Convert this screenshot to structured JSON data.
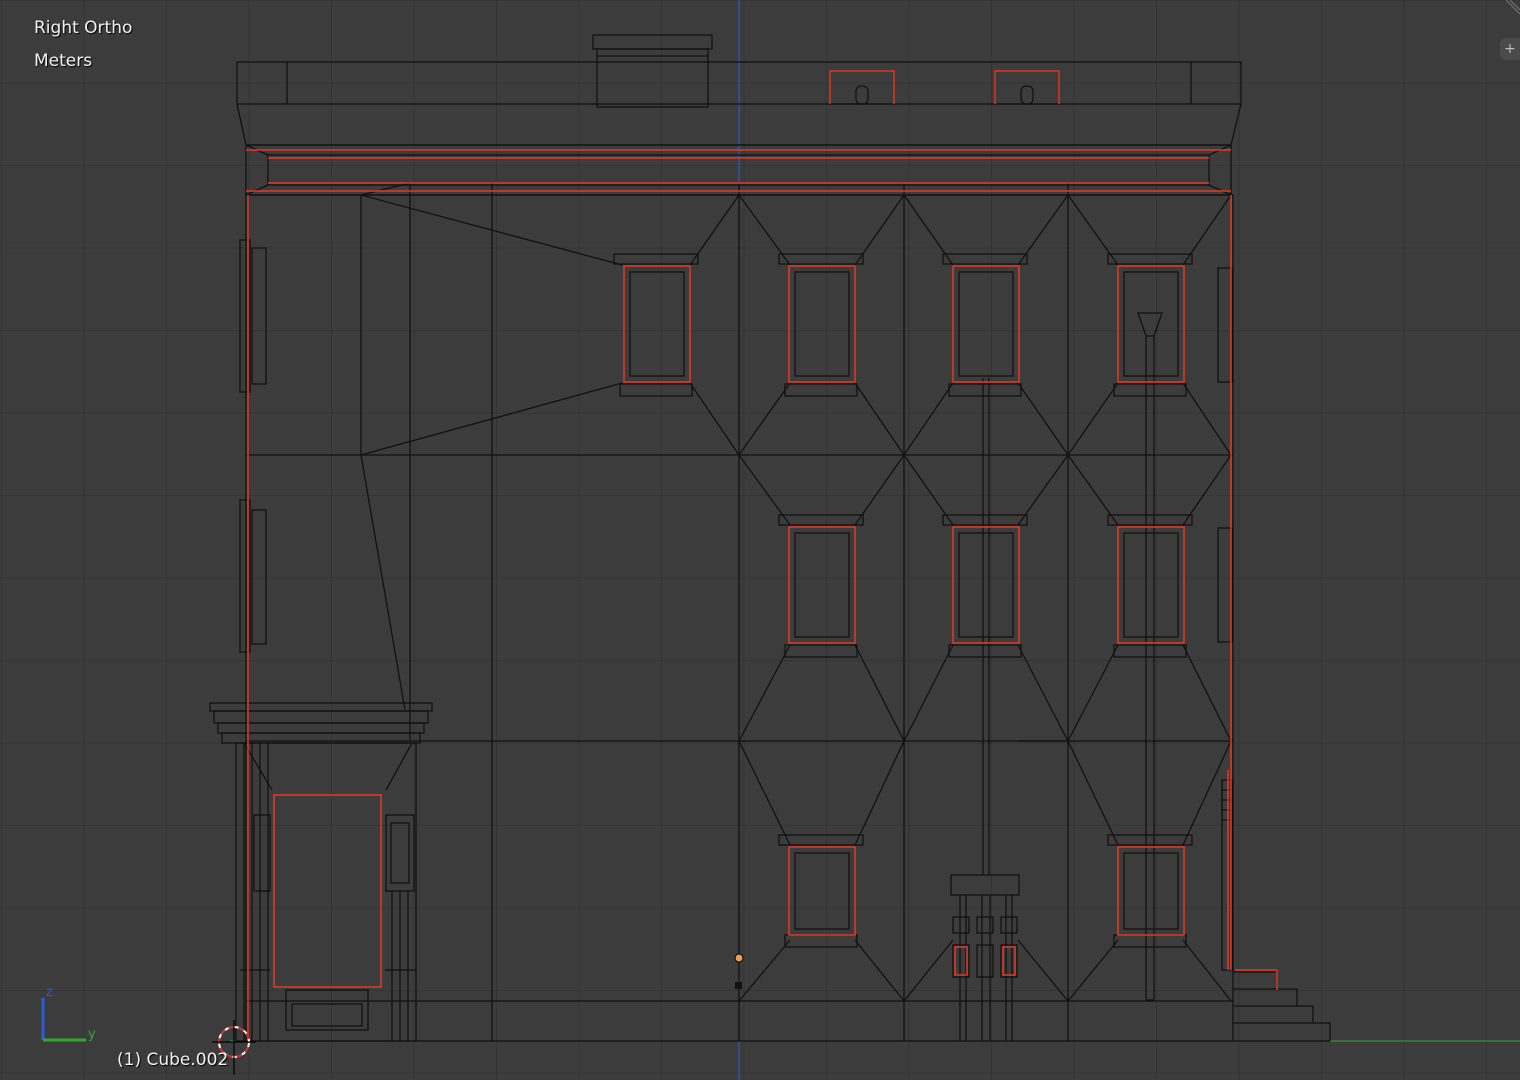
{
  "viewport": {
    "view_name": "Right Ortho",
    "units": "Meters",
    "active_object": "(1) Cube.002",
    "panel_toggle": "+",
    "axis_labels": {
      "z": "z",
      "y": "y"
    }
  },
  "colors": {
    "background": "#3c3c3c",
    "wire": "#111111",
    "selected_edge": "#e03a24",
    "z_axis": "#2a5bd8",
    "y_axis": "#2fa82f",
    "origin": "#e8a050"
  },
  "icons": [
    "3d-cursor-icon",
    "axis-gizmo-icon",
    "plus-icon",
    "corner-grip-icon",
    "object-origin-icon"
  ]
}
